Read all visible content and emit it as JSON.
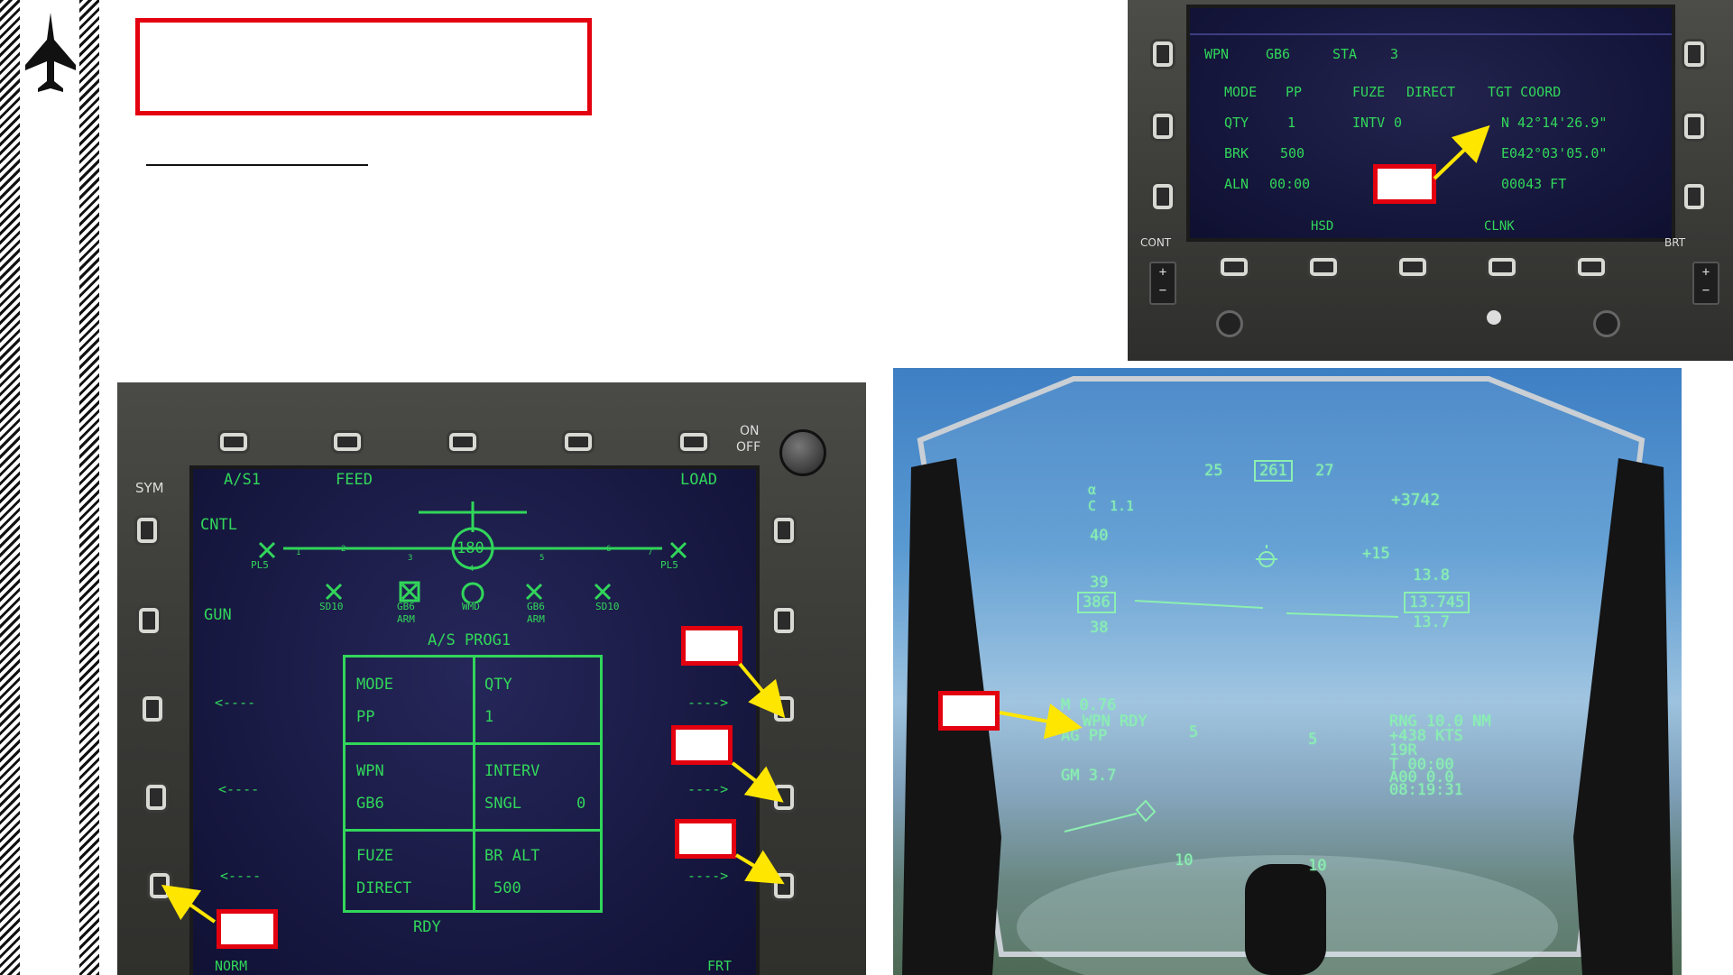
{
  "colors": {
    "accent_red": "#e3000f",
    "mfd_green": "#31d65a",
    "hud_green": "#8cf0b0",
    "arrow_yellow": "#ffe600"
  },
  "sidebar": {
    "logo_icon": "fighter-jet-icon"
  },
  "mfd_top": {
    "row1": [
      "WPN",
      "GB6",
      "STA",
      "3"
    ],
    "row2": [
      "MODE",
      "PP",
      "FUZE",
      "DIRECT",
      "TGT COORD"
    ],
    "row3": [
      "QTY",
      "1",
      "INTV",
      "0",
      "N 42°14'26.9\""
    ],
    "row4": [
      "BRK",
      "500",
      "E042°03'05.0\""
    ],
    "row5": [
      "ALN",
      "00:00",
      "00043 FT"
    ],
    "bottom": [
      "HSD",
      "CLNK"
    ],
    "side_left": "CONT",
    "side_right": "BRT"
  },
  "mfd_main": {
    "top_labels": [
      "A/S1",
      "FEED",
      "LOAD"
    ],
    "top_right": [
      "ON",
      "OFF"
    ],
    "left_labels": [
      "SYM",
      "CNTL",
      "GUN"
    ],
    "heading": "180",
    "stations": [
      "1",
      "2",
      "3",
      "4",
      "5",
      "6",
      "7"
    ],
    "stores": [
      "PL5",
      "SD10",
      "GB6",
      "WMD",
      "GB6",
      "SD10",
      "PL5"
    ],
    "arm": [
      "ARM",
      "ARM"
    ],
    "prog_title": "A/S PROG1",
    "cells": {
      "mode_label": "MODE",
      "mode_value": "PP",
      "qty_label": "QTY",
      "qty_value": "1",
      "wpn_label": "WPN",
      "wpn_value": "GB6",
      "interv_label": "INTERV",
      "interv_value": "SNGL",
      "interv_count": "0",
      "fuze_label": "FUZE",
      "fuze_value": "DIRECT",
      "bralt_label": "BR ALT",
      "bralt_value": "500"
    },
    "left_arrows": [
      "<----",
      "<----",
      "<----"
    ],
    "right_arrows": [
      "---->",
      "---->",
      "---->"
    ],
    "status": "RDY",
    "bottom_left": "NORM",
    "bottom_right": "FRT"
  },
  "hud": {
    "heading_left": "25",
    "heading_box": "261",
    "heading_right": "27",
    "alpha": "α",
    "c_value": "1.1",
    "c_label": "C",
    "altitude": "+3742",
    "speed_ticks": [
      "40",
      "39",
      "38"
    ],
    "speed_box": "386",
    "vs_value": "+15",
    "alt_ticks": [
      "13.8",
      "13.7"
    ],
    "alt_box": "13.745",
    "mach": "M 0.76",
    "wpn_rdy": "WPN RDY",
    "ag_mode": "AG  PP",
    "gm": "GM 3.7",
    "pitch_left": "5",
    "pitch_right": "5",
    "pitch_low_left": "10",
    "pitch_low_right": "10",
    "rng": "RNG 10.0 NM",
    "kts": "+438 KTS",
    "wpt": "19R",
    "time": "T 00:00",
    "a00": "A00 0.0",
    "clock": "08:19:31"
  }
}
